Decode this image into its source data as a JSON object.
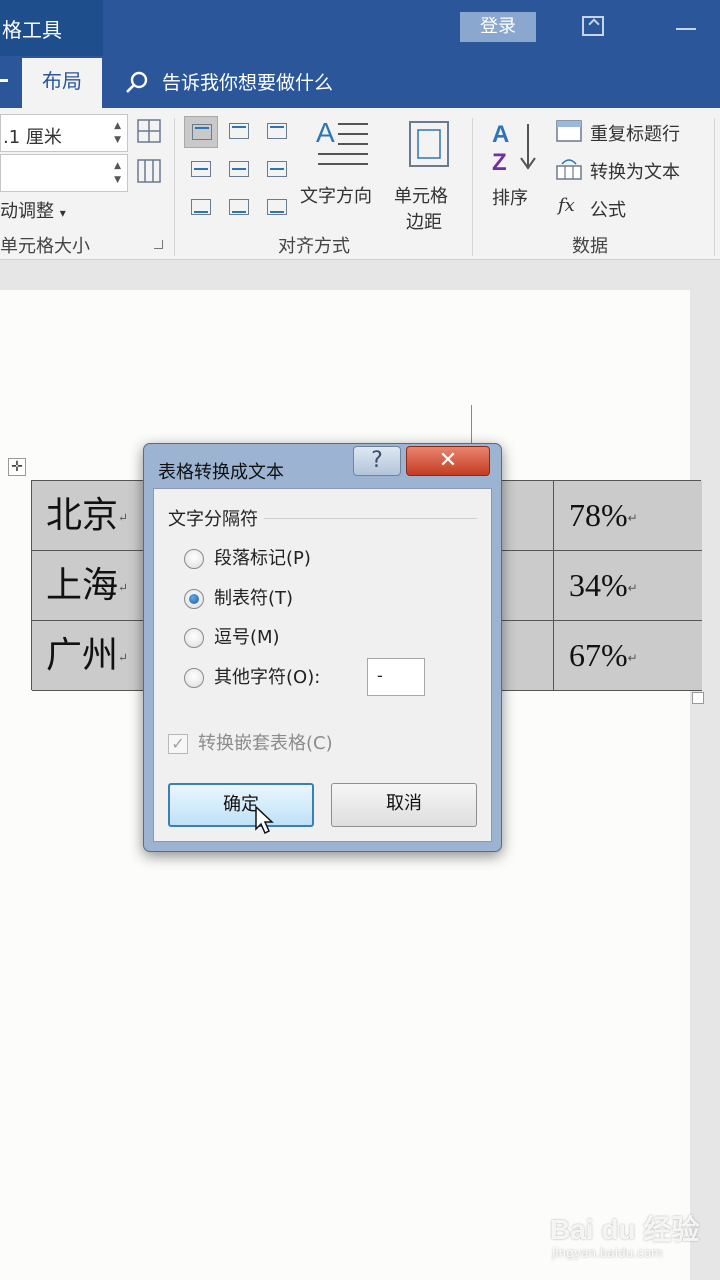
{
  "titlebar": {
    "context_tab": "格工具",
    "login": "登录"
  },
  "tabs": {
    "active": "布局",
    "tell_me": "告诉我你想要做什么"
  },
  "ribbon": {
    "cell_size": {
      "height_value": ".1 厘米",
      "width_value": "",
      "autofit": "动调整",
      "label": "单元格大小"
    },
    "alignment": {
      "text_direction": "文字方向",
      "cell_margins_line1": "单元格",
      "cell_margins_line2": "边距",
      "label": "对齐方式"
    },
    "data": {
      "sort": "排序",
      "repeat_header": "重复标题行",
      "convert_to_text": "转换为文本",
      "formula": "公式",
      "label": "数据"
    }
  },
  "table": {
    "rows": [
      {
        "city": "北京",
        "pct": "78%"
      },
      {
        "city": "上海",
        "pct": "34%"
      },
      {
        "city": "广州",
        "pct": "67%"
      }
    ],
    "cell_mark": "↵"
  },
  "dialog": {
    "title": "表格转换成文本",
    "help": "?",
    "close": "✕",
    "group_label": "文字分隔符",
    "options": [
      {
        "label": "段落标记(P)",
        "checked": false
      },
      {
        "label": "制表符(T)",
        "checked": true
      },
      {
        "label": "逗号(M)",
        "checked": false
      },
      {
        "label": "其他字符(O):",
        "checked": false
      }
    ],
    "other_char_value": "-",
    "nested_label": "转换嵌套表格(C)",
    "nested_checked": true,
    "ok": "确定",
    "cancel": "取消"
  },
  "watermark": {
    "logo": "Bai du 经验",
    "url": "jingyan.baidu.com"
  },
  "colors": {
    "title_bar": "#2b579a",
    "ribbon_bg": "#f3f3f3",
    "table_fill": "#cbcbcb",
    "close_button": "#c43c21",
    "accent_blue": "#2e75b6"
  }
}
